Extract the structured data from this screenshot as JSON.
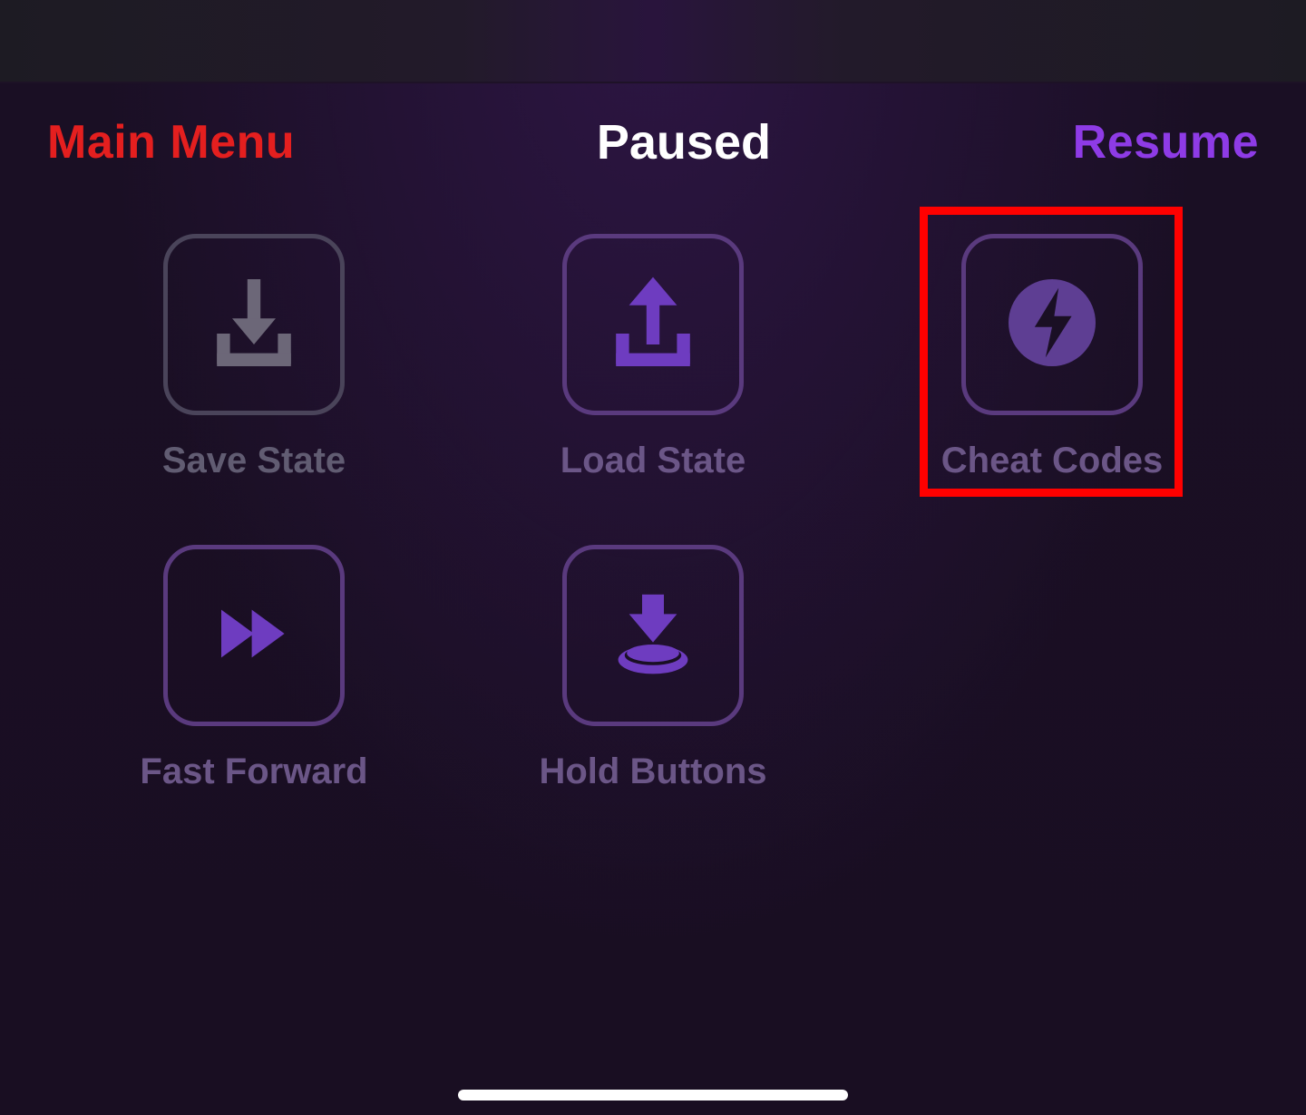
{
  "header": {
    "main_menu": "Main Menu",
    "title": "Paused",
    "resume": "Resume"
  },
  "items": {
    "save_state": {
      "label": "Save State",
      "icon": "download-icon"
    },
    "load_state": {
      "label": "Load State",
      "icon": "upload-icon"
    },
    "cheat_codes": {
      "label": "Cheat Codes",
      "icon": "lightning-icon",
      "highlighted": true
    },
    "fast_forward": {
      "label": "Fast Forward",
      "icon": "fast-forward-icon"
    },
    "hold_buttons": {
      "label": "Hold Buttons",
      "icon": "press-button-icon"
    }
  },
  "colors": {
    "danger": "#e41f1f",
    "accent": "#8e3be6",
    "tile_border": "#5a3a7e",
    "tile_border_dim": "#4a445a",
    "label": "#6b5687",
    "highlight": "#ff0000"
  }
}
